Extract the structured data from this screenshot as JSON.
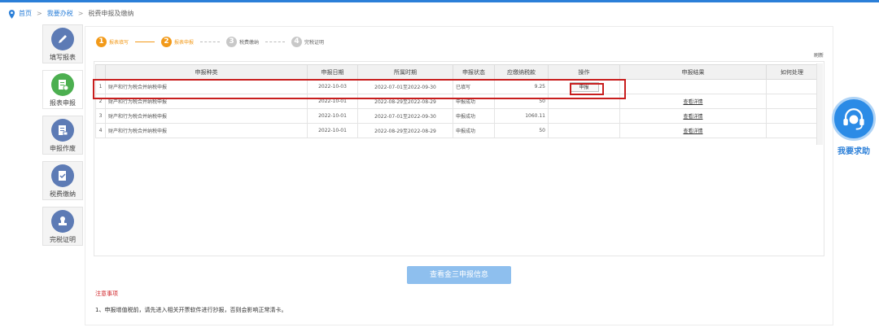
{
  "breadcrumb": {
    "home": "首页",
    "section": "我要办税",
    "current": "税费申报及缴纳",
    "separator": ">"
  },
  "sidebar": {
    "items": [
      {
        "label": "填写报表",
        "icon": "pencil-icon",
        "color": "#5d7bb5"
      },
      {
        "label": "报表申报",
        "icon": "report-submit-icon",
        "color": "#4caf50"
      },
      {
        "label": "申报作废",
        "icon": "void-document-icon",
        "color": "#5d7bb5"
      },
      {
        "label": "税费缴纳",
        "icon": "tax-payment-icon",
        "color": "#5d7bb5"
      },
      {
        "label": "完税证明",
        "icon": "certificate-stamp-icon",
        "color": "#5d7bb5"
      }
    ]
  },
  "steps": [
    {
      "num": "1",
      "label": "报表填写",
      "state": "done"
    },
    {
      "num": "2",
      "label": "报表申报",
      "state": "done"
    },
    {
      "num": "3",
      "label": "税费缴纳",
      "state": "todo"
    },
    {
      "num": "4",
      "label": "完税证明",
      "state": "todo"
    }
  ],
  "refresh": "刷新",
  "table": {
    "headers": [
      "",
      "申报种类",
      "申报日期",
      "所属时期",
      "申报状态",
      "应缴纳税款",
      "操作",
      "申报结果",
      "如何处理"
    ],
    "rows": [
      {
        "no": "1",
        "type": "财产和行为税合并纳税申报",
        "date": "2022-10-03",
        "period": "2022-07-01至2022-09-30",
        "status": "已填写",
        "tax": "9.25",
        "action": "申报",
        "result": "",
        "handle": ""
      },
      {
        "no": "2",
        "type": "财产和行为税合并纳税申报",
        "date": "2022-10-01",
        "period": "2022-08-29至2022-08-29",
        "status": "申报成功",
        "tax": "50",
        "action": "",
        "result": "查看详情",
        "handle": ""
      },
      {
        "no": "3",
        "type": "财产和行为税合并纳税申报",
        "date": "2022-10-01",
        "period": "2022-07-01至2022-09-30",
        "status": "申报成功",
        "tax": "1060.11",
        "action": "",
        "result": "查看详情",
        "handle": ""
      },
      {
        "no": "4",
        "type": "财产和行为税合并纳税申报",
        "date": "2022-10-01",
        "period": "2022-08-29至2022-08-29",
        "status": "申报成功",
        "tax": "50",
        "action": "",
        "result": "查看详情",
        "handle": ""
      }
    ]
  },
  "jinsan_button": "查看金三申报信息",
  "notice": {
    "title": "注意事项",
    "text": "1、申报增值税前，请先进入相关开票软件进行抄报，否则会影响正常清卡。"
  },
  "help": {
    "label": "我要求助"
  },
  "colors": {
    "accent": "#2b7fd8",
    "step_done": "#f29a1a",
    "highlight": "#c81e1e",
    "notice": "#d0262a"
  }
}
